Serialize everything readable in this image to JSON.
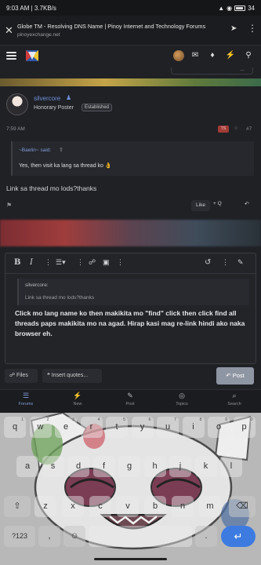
{
  "status_bar": {
    "time": "9:03 AM",
    "speed": "3.7KB/s",
    "battery": "34"
  },
  "browser": {
    "title": "Globe TM - Resolving DNS Name | Pinoy Internet and Technology Forums",
    "domain": "pinoyexchange.net"
  },
  "top_strip_text": "…",
  "post": {
    "author": "silvercore",
    "user_title": "Honorary Poster",
    "badge": "Established",
    "time": "7:59 AM",
    "ts_badge": "TS",
    "post_number": "#7",
    "quote_author": "~Baelin~ said:",
    "quote_text": "Yes, then visit ka lang sa thread ko",
    "quote_emoji": "👌",
    "body": "Link sa thread mo lods?thanks",
    "like_label": "Like",
    "quote_label": "+ Q",
    "reply_icon": "↶"
  },
  "editor": {
    "quote_author": "silvercore:",
    "quote_text": "Link sa thread mo lods?thanks",
    "draft_text": "Click mo lang name ko then makikita mo \"find\" click then click find all threads paps makikita mo na agad. Hirap kasi mag re-link hindi ako naka browser eh."
  },
  "actions": {
    "files_label": "Files",
    "insert_quotes_label": "Insert quotes...",
    "post_label": "Post"
  },
  "bottom_nav": [
    {
      "label": "Forums",
      "icon": "☰"
    },
    {
      "label": "New",
      "icon": "⚡"
    },
    {
      "label": "Post",
      "icon": "✎"
    },
    {
      "label": "Topics",
      "icon": "◎"
    },
    {
      "label": "Search",
      "icon": "⌕"
    }
  ],
  "keyboard": {
    "row1": [
      "q",
      "w",
      "e",
      "r",
      "t",
      "y",
      "u",
      "i",
      "o",
      "p"
    ],
    "row1_hints": [
      "1",
      "2",
      "3",
      "4",
      "5",
      "6",
      "7",
      "8",
      "9",
      "0"
    ],
    "row2": [
      "a",
      "s",
      "d",
      "f",
      "g",
      "h",
      "j",
      "k",
      "l"
    ],
    "row3": [
      "z",
      "x",
      "c",
      "v",
      "b",
      "n",
      "m"
    ],
    "shift": "⇧",
    "backspace": "⌫",
    "numbers_key": "?123",
    "comma": ",",
    "emoji": "☺",
    "period": ".",
    "enter": "↵",
    "colors": {
      "enter": "#3d7be0"
    }
  },
  "colors": {
    "accent": "#7f9bd6",
    "post_button": "#8f96a3",
    "ts_badge": "#a23b35"
  }
}
